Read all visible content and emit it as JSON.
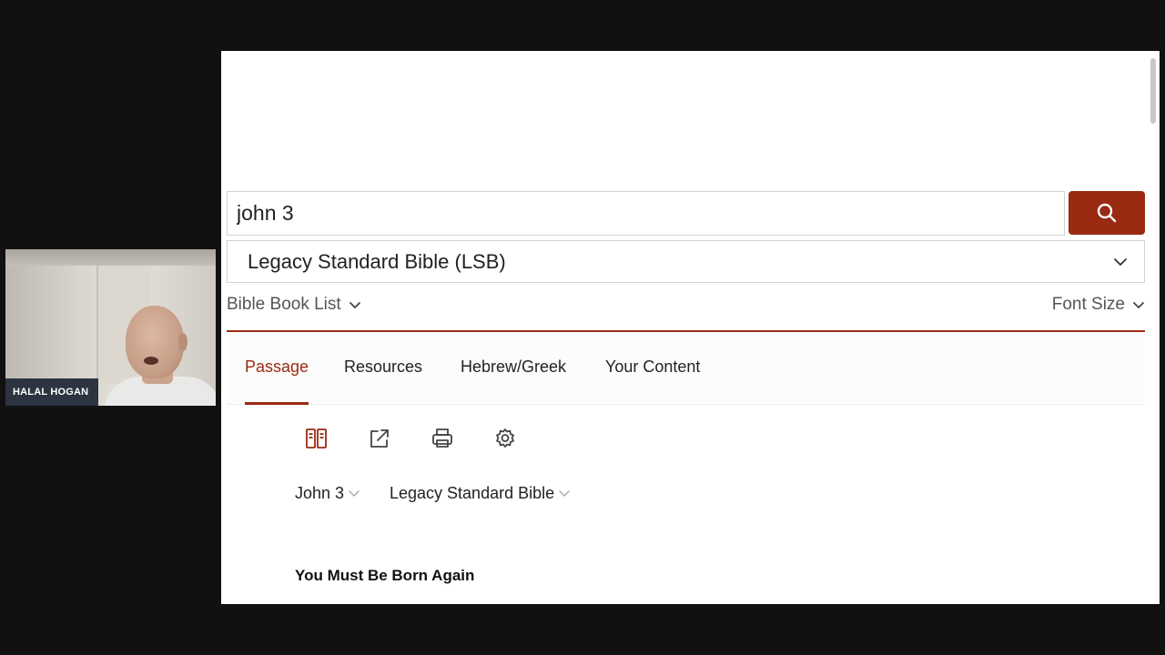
{
  "webcam": {
    "participant_name": "HALAL HOGAN"
  },
  "search": {
    "value": "john 3",
    "button_icon": "search-icon"
  },
  "version_select": {
    "selected": "Legacy Standard Bible (LSB)"
  },
  "subnav": {
    "book_list_label": "Bible Book List",
    "font_size_label": "Font Size"
  },
  "tabs": [
    {
      "label": "Passage",
      "active": true
    },
    {
      "label": "Resources",
      "active": false
    },
    {
      "label": "Hebrew/Greek",
      "active": false
    },
    {
      "label": "Your Content",
      "active": false
    }
  ],
  "toolbar": {
    "icons": [
      "parallel-icon",
      "share-icon",
      "print-icon",
      "settings-icon"
    ]
  },
  "passage": {
    "reference": "John 3",
    "version": "Legacy Standard Bible",
    "heading": "You Must Be Born Again"
  },
  "colors": {
    "accent": "#9a2a12",
    "background": "#111111"
  }
}
